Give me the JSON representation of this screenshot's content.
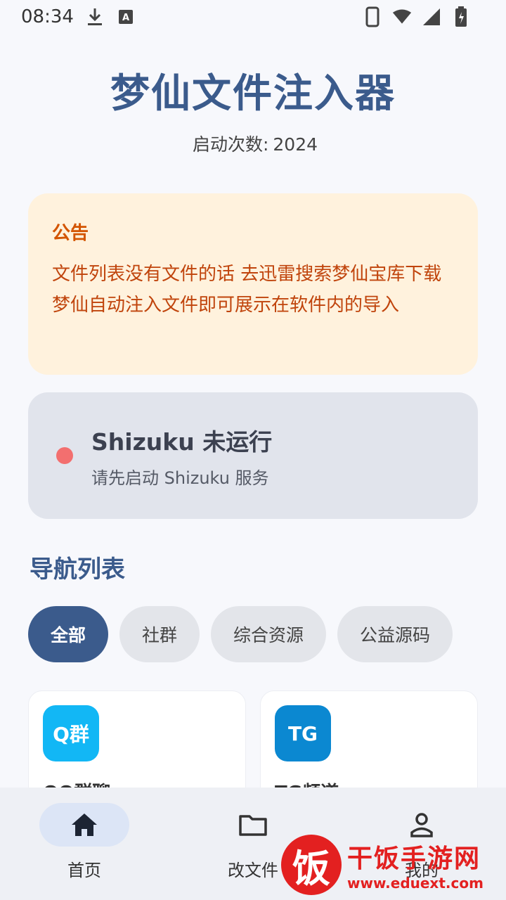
{
  "status_bar": {
    "time": "08:34",
    "icons": [
      "download-icon",
      "a-keyboard-icon",
      "phone-icon",
      "wifi-icon",
      "signal-icon",
      "battery-icon"
    ]
  },
  "header": {
    "title": "梦仙文件注入器",
    "launch_label": "启动次数:",
    "launch_count": "2024"
  },
  "notice": {
    "title": "公告",
    "body": "文件列表没有文件的话 去迅雷搜索梦仙宝库下载梦仙自动注入文件即可展示在软件内的导入"
  },
  "shizuku": {
    "title": "Shizuku 未运行",
    "subtitle": "请先启动 Shizuku 服务",
    "status_color": "#f36f6f"
  },
  "navigation": {
    "heading": "导航列表",
    "chips": [
      "全部",
      "社群",
      "综合资源",
      "公益源码"
    ],
    "selected_chip": "全部",
    "cards": [
      {
        "icon_text": "Q群",
        "name": "QQ群聊",
        "color": "#12b7f5"
      },
      {
        "icon_text": "TG",
        "name": "TG频道",
        "color": "#0b88d1"
      }
    ]
  },
  "bottom_nav": {
    "items": [
      {
        "label": "首页",
        "icon": "home-icon"
      },
      {
        "label": "改文件",
        "icon": "folder-icon"
      },
      {
        "label": "我的",
        "icon": "person-icon"
      }
    ],
    "active": "首页"
  },
  "watermark": {
    "logo_char": "饭",
    "title": "干饭手游网",
    "url": "www.eduext.com"
  }
}
